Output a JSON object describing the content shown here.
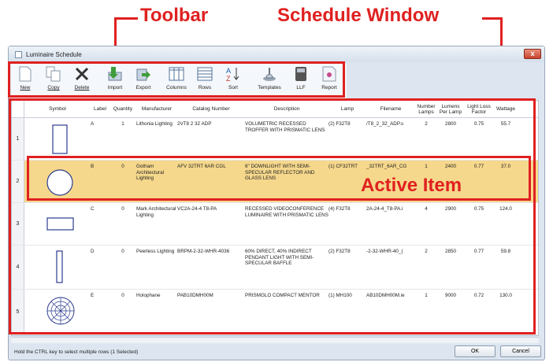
{
  "annotations": {
    "toolbar": "Toolbar",
    "schedule_window": "Schedule Window",
    "active_item": "Active Item",
    "color": "#e02020"
  },
  "window": {
    "title": "Luminaire Schedule",
    "close_glyph": "x"
  },
  "toolbar": {
    "buttons": [
      {
        "label": "New",
        "icon": "new-document-icon"
      },
      {
        "label": "Copy",
        "icon": "copy-icon"
      },
      {
        "label": "Delete",
        "icon": "delete-x-icon"
      },
      {
        "label": "Import",
        "icon": "import-arrow-icon"
      },
      {
        "label": "Export",
        "icon": "export-arrow-icon"
      },
      {
        "label": "Columns",
        "icon": "columns-icon"
      },
      {
        "label": "Rows",
        "icon": "rows-icon"
      },
      {
        "label": "Sort",
        "icon": "sort-az-icon"
      },
      {
        "label": "Templates",
        "icon": "templates-icon"
      },
      {
        "label": "LLF",
        "icon": "llf-icon"
      },
      {
        "label": "Report",
        "icon": "report-icon"
      }
    ]
  },
  "table": {
    "columns": [
      "Symbol",
      "Label",
      "Quantity",
      "Manufacturer",
      "Catalog Number",
      "Description",
      "Lamp",
      "Filename",
      "Number Lamps",
      "Lumens Per Lamp",
      "Light Loss Factor",
      "Wattage"
    ],
    "rows": [
      {
        "num": "1",
        "symbol": "tall-rectangle",
        "label": "A",
        "quantity": "1",
        "manufacturer": "Lithonia Lighting",
        "catalog": "2VT8 2 32 ADP",
        "description": "VOLUMETRIC RECESSED TROFFER WITH PRISMATIC LENS",
        "lamp": "(2) F32T8",
        "filename": "/T8_2_32_ADP.s",
        "lamps": "2",
        "lumens": "2800",
        "llf": "0.75",
        "wattage": "55.7"
      },
      {
        "num": "2",
        "symbol": "circle",
        "label": "B",
        "quantity": "0",
        "manufacturer": "Gotham Architectural Lighting",
        "catalog": "AFV 32TRT 6AR CGL",
        "description": "6\" DOWNLIGHT WITH SEMI-SPECULAR REFLECTOR AND GLASS LENS",
        "lamp": "(1) CF32TRT",
        "filename": "_32TRT_6AR_CG",
        "lamps": "1",
        "lumens": "2400",
        "llf": "0.77",
        "wattage": "37.0"
      },
      {
        "num": "3",
        "symbol": "wide-rectangle",
        "label": "C",
        "quantity": "0",
        "manufacturer": "Mark Architectural Lighting",
        "catalog": "VC2A-24-4 T8-PA",
        "description": "RECESSED VIDEOCONFERENCE LUMINAIRE WITH PRISMATIC LENS",
        "lamp": "(4) F32T8",
        "filename": "2A-24-4_T8-PA.i",
        "lamps": "4",
        "lumens": "2900",
        "llf": "0.75",
        "wattage": "124.0"
      },
      {
        "num": "4",
        "symbol": "thin-rectangle",
        "label": "D",
        "quantity": "0",
        "manufacturer": "Peerless Lighting",
        "catalog": "BRPM-2-32-WHR-4036",
        "description": "60% DIRECT, 40% INDIRECT PENDANT LIGHT WITH SEMI-SPECULAR BAFFLE",
        "lamp": "(2) F32T8",
        "filename": "-2-32-WHR-40_(",
        "lamps": "2",
        "lumens": "2850",
        "llf": "0.77",
        "wattage": "59.8"
      },
      {
        "num": "5",
        "symbol": "radial-circle",
        "label": "E",
        "quantity": "0",
        "manufacturer": "Holophane",
        "catalog": "PAB10DMH00M",
        "description": "PRISMGLO COMPACT MENTOR",
        "lamp": "(1) MH100",
        "filename": "AB10DMH00M.ie",
        "lamps": "1",
        "lumens": "9000",
        "llf": "0.72",
        "wattage": "130.0"
      }
    ]
  },
  "status": "Hold the CTRL key to select multiple rows (1 Selected)",
  "buttons": {
    "ok": "OK",
    "cancel": "Cancel"
  }
}
